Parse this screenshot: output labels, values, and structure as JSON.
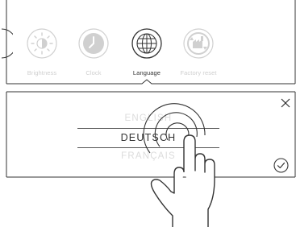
{
  "top_menu": {
    "items": [
      {
        "label": "Brightness",
        "icon": "brightness-icon",
        "state": "inactive"
      },
      {
        "label": "Clock",
        "icon": "clock-icon",
        "state": "inactive"
      },
      {
        "label": "Language",
        "icon": "globe-icon",
        "state": "selected"
      },
      {
        "label": "Factory reset",
        "icon": "factory-reset-icon",
        "state": "inactive"
      }
    ]
  },
  "language_picker": {
    "options": [
      "ENGLISH",
      "DEUTSCH",
      "FRANÇAIS"
    ],
    "selected": "DEUTSCH",
    "close_icon": "close-icon",
    "confirm_icon": "check-circle-icon"
  },
  "overlay": {
    "gesture": "tap-hand-icon"
  },
  "colors": {
    "line": "#333333",
    "inactive": "#cfcfcf",
    "background": "#ffffff"
  }
}
